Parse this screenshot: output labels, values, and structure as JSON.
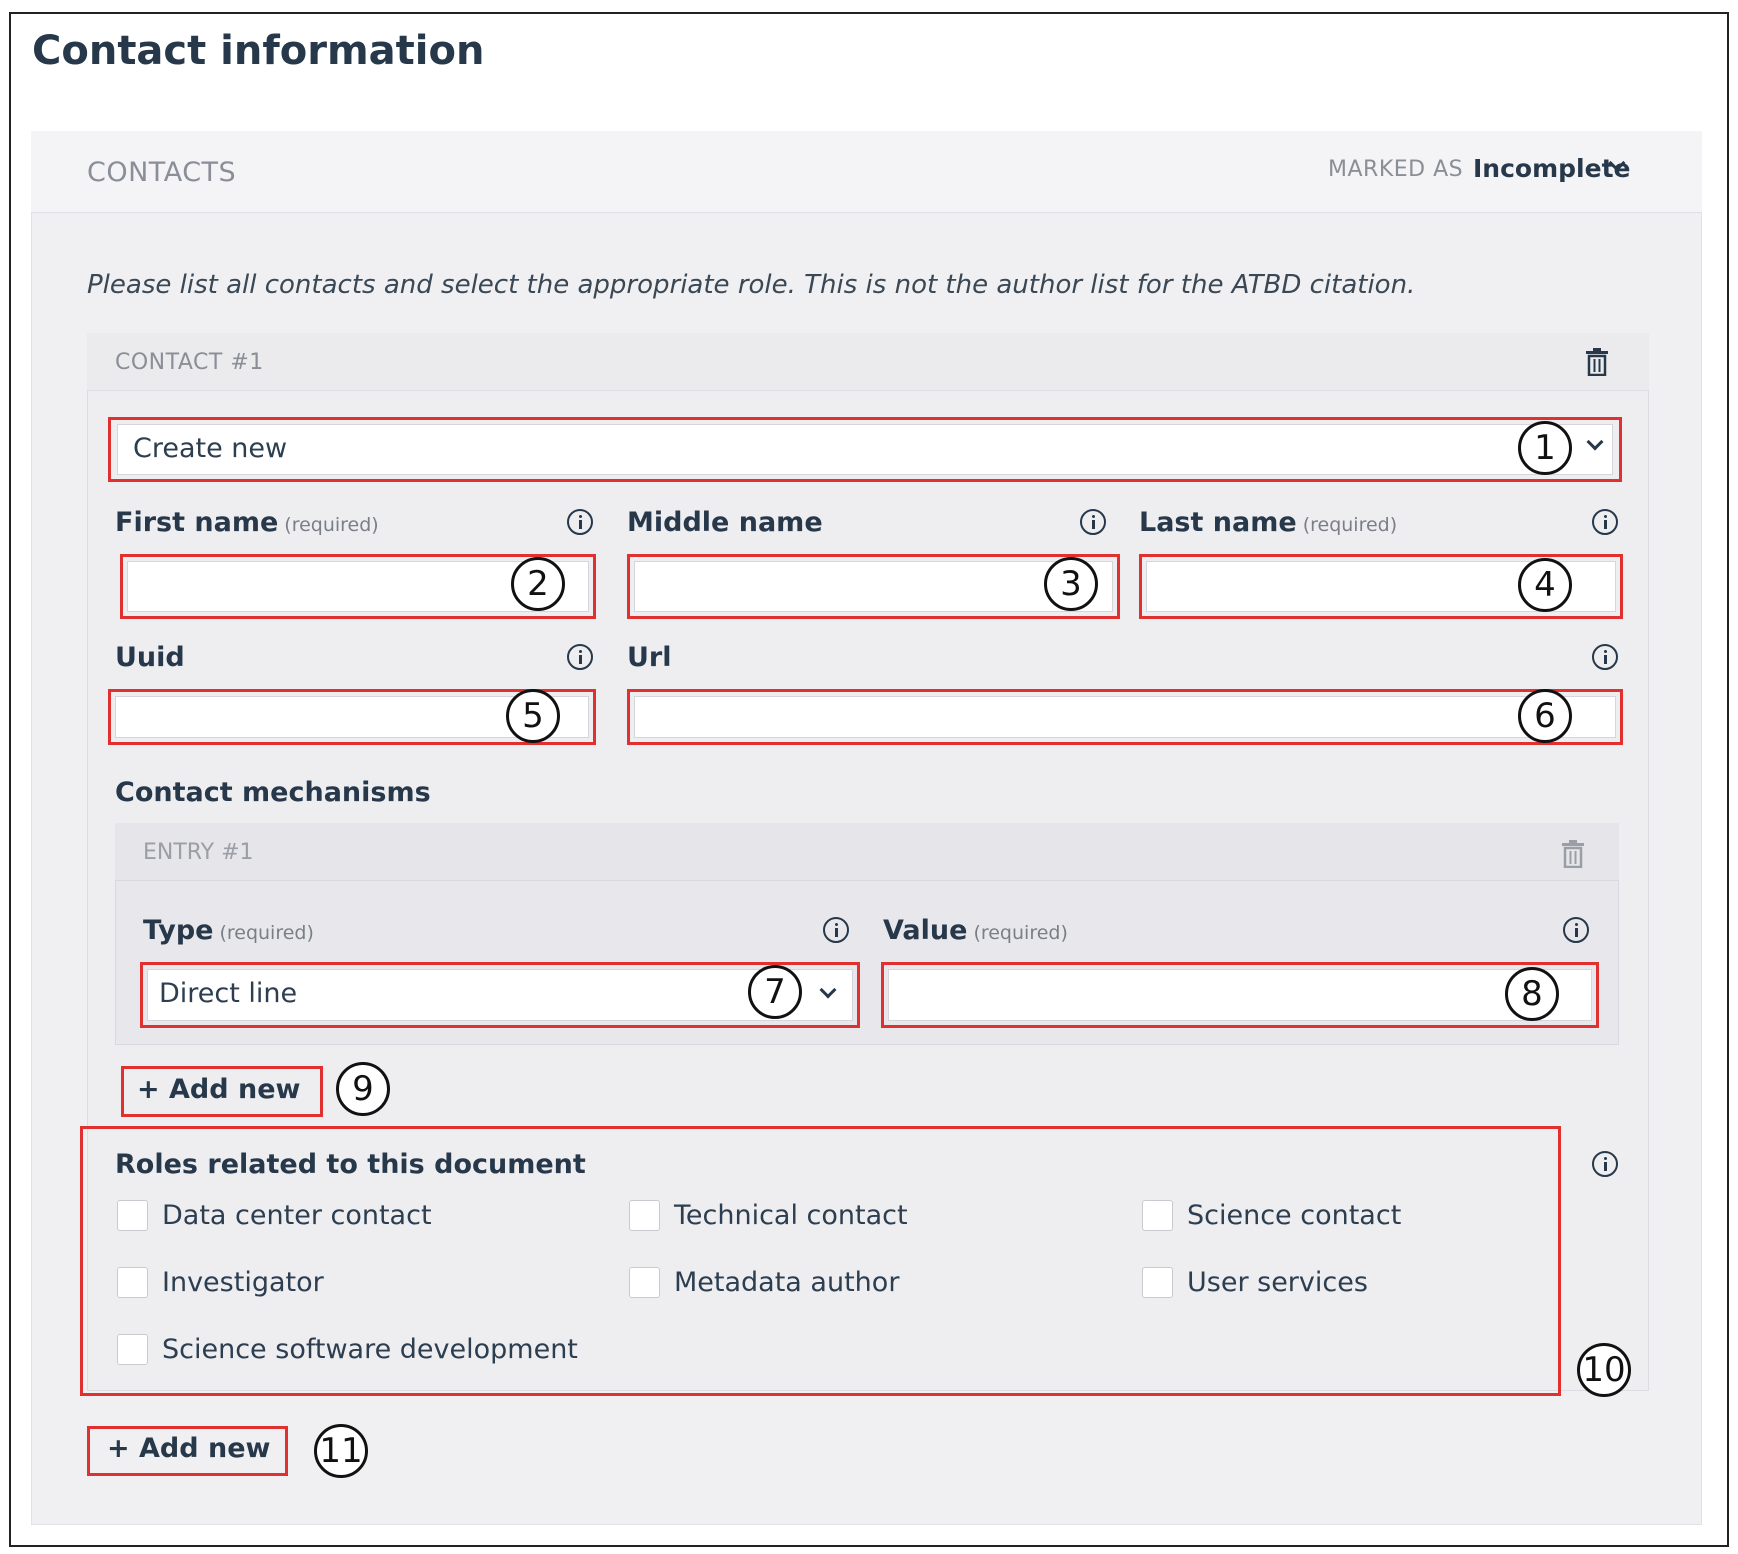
{
  "page": {
    "title": "Contact information"
  },
  "section": {
    "label": "CONTACTS",
    "marked_as_label": "MARKED AS",
    "status": "Incomplete",
    "intro": "Please list all contacts and select the appropriate role. This is not the author list for the ATBD citation."
  },
  "contact": {
    "label": "CONTACT #1",
    "select_value": "Create new",
    "required_hint": "(required)",
    "fields": {
      "first_name": "First name",
      "middle_name": "Middle name",
      "last_name": "Last name",
      "uuid": "Uuid",
      "url": "Url"
    },
    "mechanisms": {
      "title": "Contact mechanisms",
      "entry_label": "ENTRY #1",
      "type_label": "Type",
      "type_value": "Direct line",
      "value_label": "Value",
      "add_label": "Add new"
    },
    "roles": {
      "title": "Roles related to this document",
      "options": [
        "Data center contact",
        "Technical contact",
        "Science contact",
        "Investigator",
        "Metadata author",
        "User services",
        "Science software development"
      ]
    }
  },
  "add_contact_label": "Add new",
  "callouts": [
    "1",
    "2",
    "3",
    "4",
    "5",
    "6",
    "7",
    "8",
    "9",
    "10",
    "11"
  ]
}
